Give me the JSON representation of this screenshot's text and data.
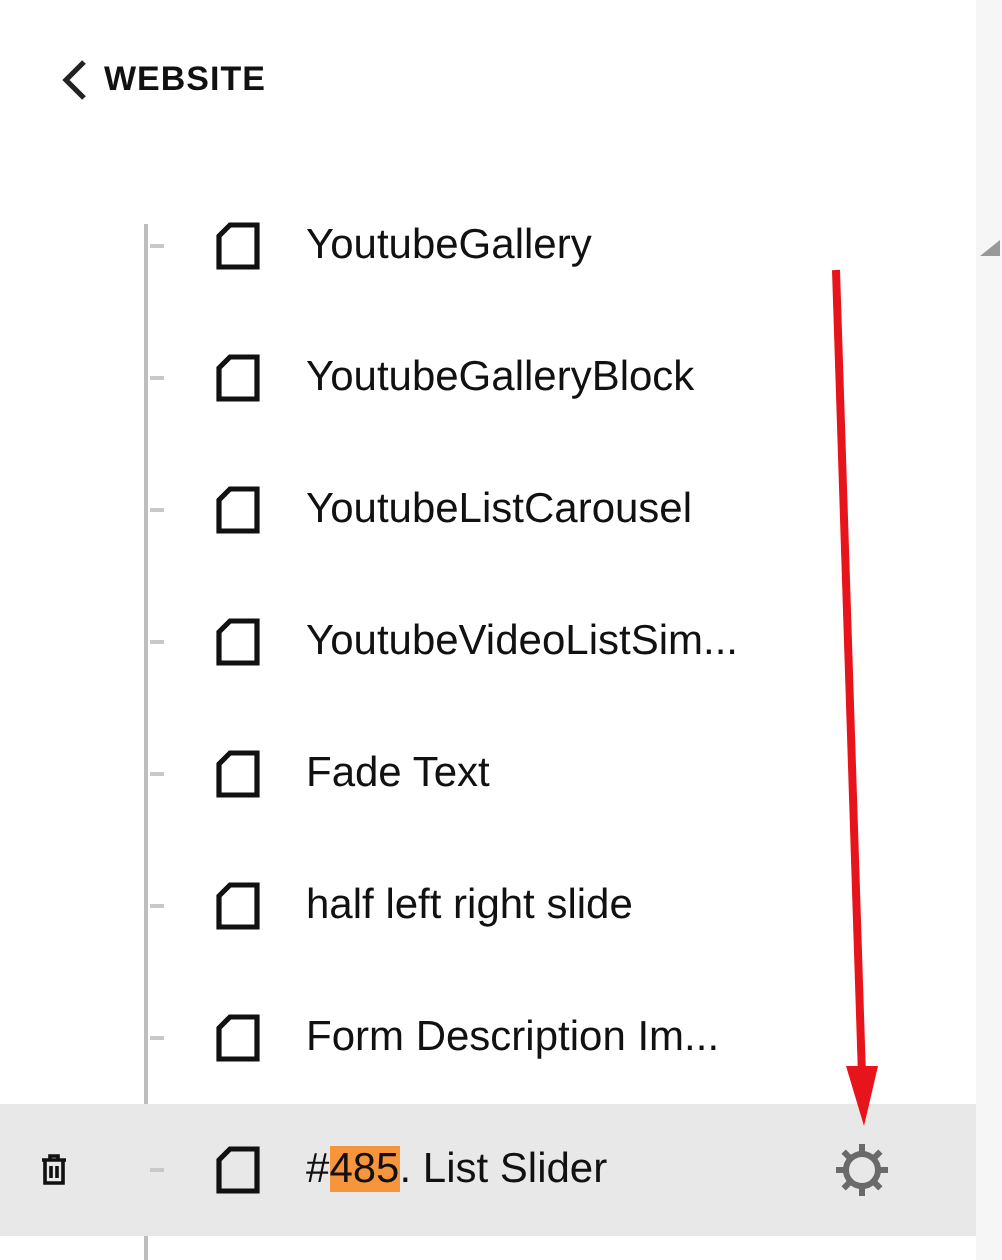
{
  "header": {
    "back_label": "WEBSITE"
  },
  "pages": [
    {
      "label_parts": [
        {
          "text": "YoutubeGallery",
          "highlighted": false
        }
      ],
      "selected": false
    },
    {
      "label_parts": [
        {
          "text": "YoutubeGalleryBlock",
          "highlighted": false
        }
      ],
      "selected": false
    },
    {
      "label_parts": [
        {
          "text": "YoutubeListCarousel",
          "highlighted": false
        }
      ],
      "selected": false
    },
    {
      "label_parts": [
        {
          "text": "YoutubeVideoListSim...",
          "highlighted": false
        }
      ],
      "selected": false
    },
    {
      "label_parts": [
        {
          "text": "Fade Text",
          "highlighted": false
        }
      ],
      "selected": false
    },
    {
      "label_parts": [
        {
          "text": "half left right slide",
          "highlighted": false
        }
      ],
      "selected": false
    },
    {
      "label_parts": [
        {
          "text": "Form Description Im...",
          "highlighted": false
        }
      ],
      "selected": false
    },
    {
      "label_parts": [
        {
          "text": "#",
          "highlighted": false
        },
        {
          "text": "485",
          "highlighted": true
        },
        {
          "text": ". List Slider",
          "highlighted": false
        }
      ],
      "selected": true
    }
  ]
}
